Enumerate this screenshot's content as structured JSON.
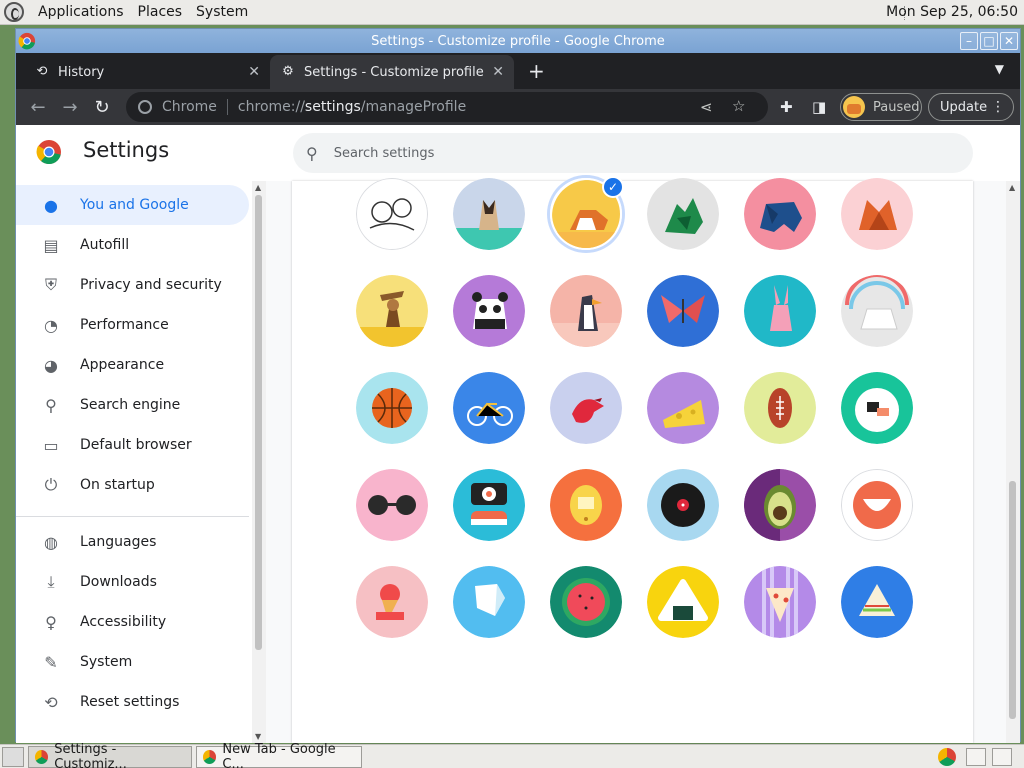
{
  "desktop": {
    "menu": [
      "Applications",
      "Places",
      "System"
    ],
    "clock": "Mon Sep 25, 06:50"
  },
  "window": {
    "title": "Settings - Customize profile - Google Chrome",
    "controls": [
      "minimize",
      "maximize",
      "close"
    ]
  },
  "tabs": [
    {
      "label": "History",
      "icon": "history-icon"
    },
    {
      "label": "Settings - Customize profile",
      "icon": "gear-icon"
    }
  ],
  "toolbar": {
    "omnibox_site": "Chrome",
    "url_scheme": "chrome://",
    "url_host": "settings",
    "url_path": "/manageProfile",
    "profile_status": "Paused",
    "update_label": "Update"
  },
  "settings": {
    "title": "Settings",
    "search_placeholder": "Search settings",
    "nav": [
      {
        "label": "You and Google",
        "icon": "person-icon",
        "active": true
      },
      {
        "label": "Autofill",
        "icon": "clipboard-icon"
      },
      {
        "label": "Privacy and security",
        "icon": "shield-icon"
      },
      {
        "label": "Performance",
        "icon": "gauge-icon"
      },
      {
        "label": "Appearance",
        "icon": "palette-icon"
      },
      {
        "label": "Search engine",
        "icon": "search-icon"
      },
      {
        "label": "Default browser",
        "icon": "browser-icon"
      },
      {
        "label": "On startup",
        "icon": "power-icon"
      },
      {
        "label": "Languages",
        "icon": "globe-icon"
      },
      {
        "label": "Downloads",
        "icon": "download-icon"
      },
      {
        "label": "Accessibility",
        "icon": "accessibility-icon"
      },
      {
        "label": "System",
        "icon": "wrench-icon"
      },
      {
        "label": "Reset settings",
        "icon": "reset-icon"
      }
    ]
  },
  "avatars": {
    "selected_index": 2,
    "items": [
      {
        "name": "sketch",
        "bg": "#ffffff"
      },
      {
        "name": "cat",
        "bg": "#c9d6ea"
      },
      {
        "name": "corgi",
        "bg": "#f7c948"
      },
      {
        "name": "dragon",
        "bg": "#e3e3e3"
      },
      {
        "name": "elephant",
        "bg": "#f48fa0"
      },
      {
        "name": "fox",
        "bg": "#fbd1d4"
      },
      {
        "name": "monkey",
        "bg": "#f7e07a"
      },
      {
        "name": "panda",
        "bg": "#b57ad8"
      },
      {
        "name": "penguin",
        "bg": "#f5b4a8"
      },
      {
        "name": "butterfly",
        "bg": "#2f6fd6"
      },
      {
        "name": "rabbit",
        "bg": "#20b8c8"
      },
      {
        "name": "unicorn",
        "bg": "#e7e7e7"
      },
      {
        "name": "basketball",
        "bg": "#a9e4ee"
      },
      {
        "name": "bike",
        "bg": "#3a86e8"
      },
      {
        "name": "bird",
        "bg": "#c9d0ee"
      },
      {
        "name": "cheese",
        "bg": "#b58ae0"
      },
      {
        "name": "football",
        "bg": "#e2ec9a"
      },
      {
        "name": "sushi-plate",
        "bg": "#18c49a"
      },
      {
        "name": "sunglasses",
        "bg": "#f8b4cc"
      },
      {
        "name": "sushi",
        "bg": "#2bbcd8"
      },
      {
        "name": "tamagotchi",
        "bg": "#f5703e"
      },
      {
        "name": "vinyl",
        "bg": "#a8d8f0"
      },
      {
        "name": "avocado",
        "bg": "#9a4ea8"
      },
      {
        "name": "smile",
        "bg": "#ffffff"
      },
      {
        "name": "ice-cream",
        "bg": "#f6c0c4"
      },
      {
        "name": "note",
        "bg": "#52bdf0"
      },
      {
        "name": "watermelon",
        "bg": "#138a6e"
      },
      {
        "name": "onigiri",
        "bg": "#f8d40e"
      },
      {
        "name": "pizza",
        "bg": "#b48ae8"
      },
      {
        "name": "sandwich",
        "bg": "#2f7ee6"
      }
    ]
  },
  "taskbar": {
    "items": [
      {
        "label": "Settings - Customiz...",
        "active": true
      },
      {
        "label": "New Tab - Google C...",
        "active": false
      }
    ]
  }
}
